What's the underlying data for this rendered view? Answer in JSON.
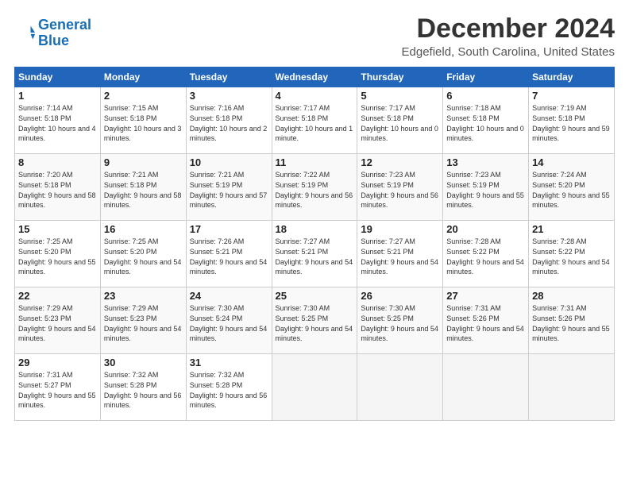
{
  "header": {
    "logo_line1": "General",
    "logo_line2": "Blue",
    "month": "December 2024",
    "location": "Edgefield, South Carolina, United States"
  },
  "columns": [
    "Sunday",
    "Monday",
    "Tuesday",
    "Wednesday",
    "Thursday",
    "Friday",
    "Saturday"
  ],
  "weeks": [
    [
      {
        "day": "1",
        "sunrise": "7:14 AM",
        "sunset": "5:18 PM",
        "daylight": "10 hours and 4 minutes."
      },
      {
        "day": "2",
        "sunrise": "7:15 AM",
        "sunset": "5:18 PM",
        "daylight": "10 hours and 3 minutes."
      },
      {
        "day": "3",
        "sunrise": "7:16 AM",
        "sunset": "5:18 PM",
        "daylight": "10 hours and 2 minutes."
      },
      {
        "day": "4",
        "sunrise": "7:17 AM",
        "sunset": "5:18 PM",
        "daylight": "10 hours and 1 minute."
      },
      {
        "day": "5",
        "sunrise": "7:17 AM",
        "sunset": "5:18 PM",
        "daylight": "10 hours and 0 minutes."
      },
      {
        "day": "6",
        "sunrise": "7:18 AM",
        "sunset": "5:18 PM",
        "daylight": "10 hours and 0 minutes."
      },
      {
        "day": "7",
        "sunrise": "7:19 AM",
        "sunset": "5:18 PM",
        "daylight": "9 hours and 59 minutes."
      }
    ],
    [
      {
        "day": "8",
        "sunrise": "7:20 AM",
        "sunset": "5:18 PM",
        "daylight": "9 hours and 58 minutes."
      },
      {
        "day": "9",
        "sunrise": "7:21 AM",
        "sunset": "5:18 PM",
        "daylight": "9 hours and 58 minutes."
      },
      {
        "day": "10",
        "sunrise": "7:21 AM",
        "sunset": "5:19 PM",
        "daylight": "9 hours and 57 minutes."
      },
      {
        "day": "11",
        "sunrise": "7:22 AM",
        "sunset": "5:19 PM",
        "daylight": "9 hours and 56 minutes."
      },
      {
        "day": "12",
        "sunrise": "7:23 AM",
        "sunset": "5:19 PM",
        "daylight": "9 hours and 56 minutes."
      },
      {
        "day": "13",
        "sunrise": "7:23 AM",
        "sunset": "5:19 PM",
        "daylight": "9 hours and 55 minutes."
      },
      {
        "day": "14",
        "sunrise": "7:24 AM",
        "sunset": "5:20 PM",
        "daylight": "9 hours and 55 minutes."
      }
    ],
    [
      {
        "day": "15",
        "sunrise": "7:25 AM",
        "sunset": "5:20 PM",
        "daylight": "9 hours and 55 minutes."
      },
      {
        "day": "16",
        "sunrise": "7:25 AM",
        "sunset": "5:20 PM",
        "daylight": "9 hours and 54 minutes."
      },
      {
        "day": "17",
        "sunrise": "7:26 AM",
        "sunset": "5:21 PM",
        "daylight": "9 hours and 54 minutes."
      },
      {
        "day": "18",
        "sunrise": "7:27 AM",
        "sunset": "5:21 PM",
        "daylight": "9 hours and 54 minutes."
      },
      {
        "day": "19",
        "sunrise": "7:27 AM",
        "sunset": "5:21 PM",
        "daylight": "9 hours and 54 minutes."
      },
      {
        "day": "20",
        "sunrise": "7:28 AM",
        "sunset": "5:22 PM",
        "daylight": "9 hours and 54 minutes."
      },
      {
        "day": "21",
        "sunrise": "7:28 AM",
        "sunset": "5:22 PM",
        "daylight": "9 hours and 54 minutes."
      }
    ],
    [
      {
        "day": "22",
        "sunrise": "7:29 AM",
        "sunset": "5:23 PM",
        "daylight": "9 hours and 54 minutes."
      },
      {
        "day": "23",
        "sunrise": "7:29 AM",
        "sunset": "5:23 PM",
        "daylight": "9 hours and 54 minutes."
      },
      {
        "day": "24",
        "sunrise": "7:30 AM",
        "sunset": "5:24 PM",
        "daylight": "9 hours and 54 minutes."
      },
      {
        "day": "25",
        "sunrise": "7:30 AM",
        "sunset": "5:25 PM",
        "daylight": "9 hours and 54 minutes."
      },
      {
        "day": "26",
        "sunrise": "7:30 AM",
        "sunset": "5:25 PM",
        "daylight": "9 hours and 54 minutes."
      },
      {
        "day": "27",
        "sunrise": "7:31 AM",
        "sunset": "5:26 PM",
        "daylight": "9 hours and 54 minutes."
      },
      {
        "day": "28",
        "sunrise": "7:31 AM",
        "sunset": "5:26 PM",
        "daylight": "9 hours and 55 minutes."
      }
    ],
    [
      {
        "day": "29",
        "sunrise": "7:31 AM",
        "sunset": "5:27 PM",
        "daylight": "9 hours and 55 minutes."
      },
      {
        "day": "30",
        "sunrise": "7:32 AM",
        "sunset": "5:28 PM",
        "daylight": "9 hours and 56 minutes."
      },
      {
        "day": "31",
        "sunrise": "7:32 AM",
        "sunset": "5:28 PM",
        "daylight": "9 hours and 56 minutes."
      },
      null,
      null,
      null,
      null
    ]
  ]
}
